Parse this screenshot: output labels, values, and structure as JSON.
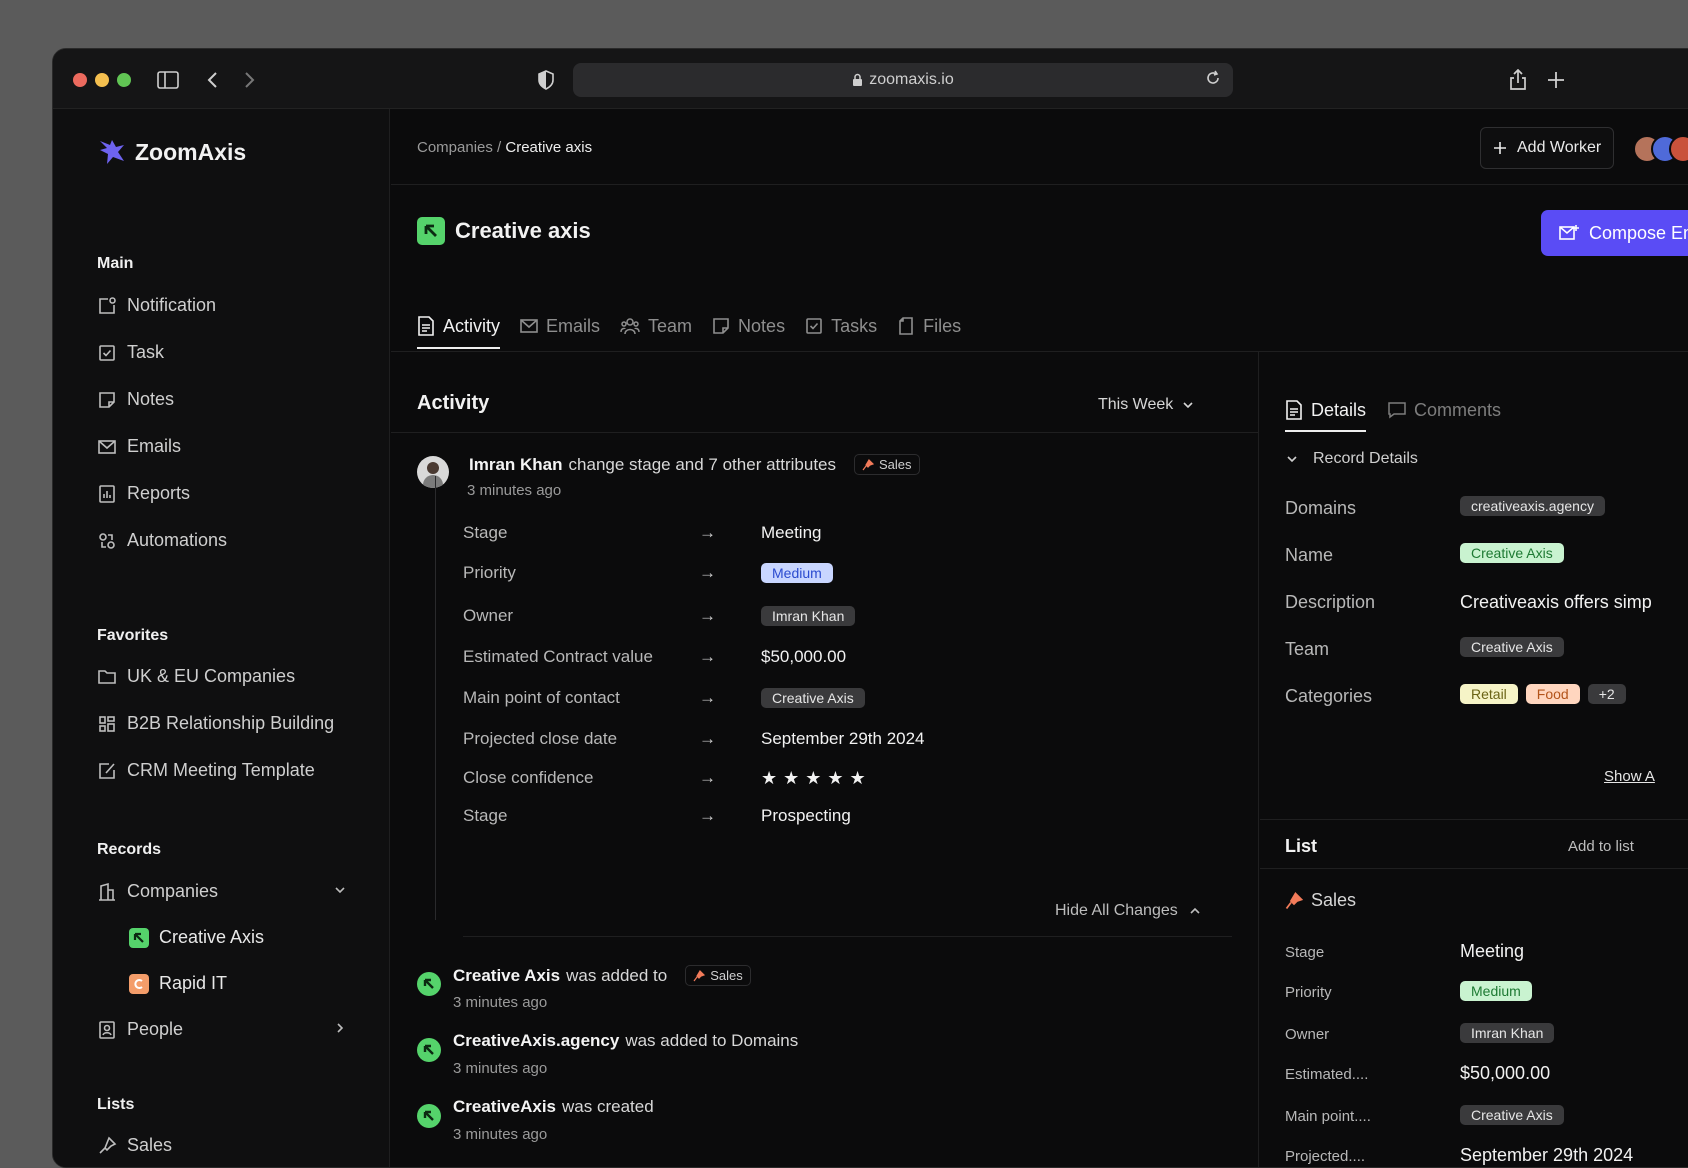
{
  "browser": {
    "url": "zoomaxis.io"
  },
  "brand": {
    "name": "ZoomAxis",
    "accent": "#5a4cf5"
  },
  "sidebar": {
    "main_label": "Main",
    "main_items": [
      {
        "label": "Notification",
        "icon": "notification-icon"
      },
      {
        "label": "Task",
        "icon": "task-check-icon"
      },
      {
        "label": "Notes",
        "icon": "notes-icon"
      },
      {
        "label": "Emails",
        "icon": "mail-icon"
      },
      {
        "label": "Reports",
        "icon": "reports-icon"
      },
      {
        "label": "Automations",
        "icon": "automations-icon"
      }
    ],
    "favorites_label": "Favorites",
    "favorites": [
      {
        "label": "UK & EU Companies",
        "icon": "folder-icon"
      },
      {
        "label": "B2B Relationship Building",
        "icon": "grid-icon"
      },
      {
        "label": "CRM Meeting Template",
        "icon": "template-icon"
      }
    ],
    "records_label": "Records",
    "companies": "Companies",
    "company_items": [
      "Creative Axis",
      "Rapid IT"
    ],
    "people": "People",
    "lists_label": "Lists",
    "lists": [
      "Sales"
    ]
  },
  "header": {
    "breadcrumb_parent": "Companies",
    "breadcrumb_sep": " / ",
    "breadcrumb_current": "Creative axis",
    "add_worker": "Add Worker",
    "title": "Creative axis",
    "compose": "Compose Em"
  },
  "tabs": [
    "Activity",
    "Emails",
    "Team",
    "Notes",
    "Tasks",
    "Files"
  ],
  "activity": {
    "heading": "Activity",
    "filter": "This Week",
    "event1": {
      "user": "Imran Khan",
      "text": "change stage and 7 other attributes",
      "chip": "Sales",
      "time": "3 minutes ago"
    },
    "changes": [
      {
        "label": "Stage",
        "value": "Meeting"
      },
      {
        "label": "Priority",
        "value": "Medium"
      },
      {
        "label": "Owner",
        "value": "Imran Khan"
      },
      {
        "label": "Estimated Contract value",
        "value": "$50,000.00"
      },
      {
        "label": "Main point of contact",
        "value": "Creative Axis"
      },
      {
        "label": "Projected close date",
        "value": "September 29th 2024"
      },
      {
        "label": "Close confidence",
        "value": "★★★★★",
        "rating": 5
      },
      {
        "label": "Stage",
        "value": "Prospecting"
      }
    ],
    "hide_changes": "Hide All Changes",
    "event2": {
      "subject": "Creative Axis",
      "text": "was added to",
      "chip": "Sales",
      "time": "3 minutes ago"
    },
    "event3": {
      "subject": "CreativeAxis.agency",
      "text": "was added to Domains",
      "time": "3 minutes ago"
    },
    "event4": {
      "subject": "CreativeAxis",
      "text": "was created",
      "time": "3 minutes ago"
    }
  },
  "details": {
    "tab_details": "Details",
    "tab_comments": "Comments",
    "record_details": "Record Details",
    "domains_label": "Domains",
    "domains": "creativeaxis.agency",
    "name_label": "Name",
    "name": "Creative Axis",
    "description_label": "Description",
    "description": "Creativeaxis offers simp",
    "team_label": "Team",
    "team": "Creative Axis",
    "categories_label": "Categories",
    "categories": [
      "Retail",
      "Food",
      "+2"
    ],
    "show_all": "Show A",
    "list_heading": "List",
    "add_to_list": "Add to list",
    "list_name": "Sales",
    "list_rows": [
      {
        "label": "Stage",
        "value": "Meeting"
      },
      {
        "label": "Priority",
        "value": "Medium"
      },
      {
        "label": "Owner",
        "value": "Imran Khan"
      },
      {
        "label": "Estimated....",
        "value": "$50,000.00"
      },
      {
        "label": "Main point....",
        "value": "Creative Axis"
      },
      {
        "label": "Projected....",
        "value": "September 29th 2024"
      }
    ]
  }
}
